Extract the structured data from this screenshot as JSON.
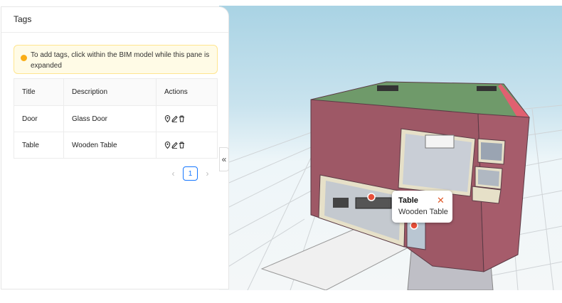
{
  "panel": {
    "title": "Tags",
    "notice": "To add tags, click within the BIM model while this pane is expanded",
    "notice_icon": "bulb-icon"
  },
  "table": {
    "columns": [
      "Title",
      "Description",
      "Actions"
    ],
    "rows": [
      {
        "title": "Door",
        "description": "Glass Door",
        "actions": [
          "locate-icon",
          "edit-icon",
          "delete-icon"
        ]
      },
      {
        "title": "Table",
        "description": "Wooden Table",
        "actions": [
          "locate-icon",
          "edit-icon",
          "delete-icon"
        ]
      }
    ]
  },
  "pagination": {
    "prev": "‹",
    "current": "1",
    "next": "›"
  },
  "collapse_label": "«",
  "tooltip": {
    "title": "Table",
    "description": "Wooden Table",
    "close": "✕"
  },
  "colors": {
    "accent": "#1677ff",
    "notice_bg": "#fffbe6",
    "notice_border": "#ffe58f",
    "tag_marker": "#e8503a",
    "building_wall": "#9e5866",
    "roof": "#6f9a6a"
  }
}
